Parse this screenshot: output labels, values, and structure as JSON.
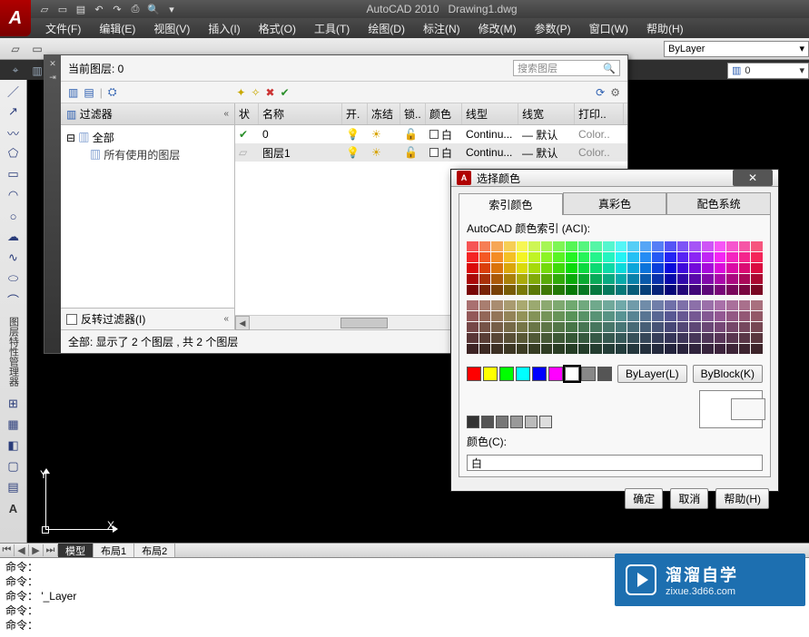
{
  "app": {
    "title": "AutoCAD 2010",
    "doc": "Drawing1.dwg"
  },
  "menu": {
    "file": "文件(F)",
    "edit": "编辑(E)",
    "view": "视图(V)",
    "insert": "插入(I)",
    "format": "格式(O)",
    "tools": "工具(T)",
    "draw": "绘图(D)",
    "dim": "标注(N)",
    "modify": "修改(M)",
    "param": "参数(P)",
    "window": "窗口(W)",
    "help": "帮助(H)"
  },
  "toolbar": {
    "bylayer": "ByLayer",
    "layer0": "0"
  },
  "ucs": {
    "x": "X",
    "y": "Y"
  },
  "tabs": {
    "model": "模型",
    "layout1": "布局1",
    "layout2": "布局2"
  },
  "cmd": {
    "l1": "命令：",
    "l2": "命令：",
    "l3": "命令： '_Layer",
    "l4": "命令：",
    "l5": "",
    "l6": "命令："
  },
  "layerPanel": {
    "currentLabel": "当前图层: 0",
    "searchPlaceholder": "搜索图层",
    "filterTitle": "过滤器",
    "treeAll": "全部",
    "treeUsed": "所有使用的图层",
    "invert": "反转过滤器(I)",
    "status": "全部: 显示了 2 个图层 , 共 2 个图层",
    "cols": {
      "state": "状",
      "name": "名称",
      "on": "开.",
      "freeze": "冻结",
      "lock": "锁..",
      "color": "颜色",
      "ltype": "线型",
      "lweight": "线宽",
      "print": "打印.."
    },
    "rows": [
      {
        "name": "0",
        "color": "白",
        "ltype": "Continu...",
        "lweight": "默认",
        "print": "Color.."
      },
      {
        "name": "图层1",
        "color": "白",
        "ltype": "Continu...",
        "lweight": "默认",
        "print": "Color.."
      }
    ]
  },
  "colorDlg": {
    "title": "选择颜色",
    "tabs": {
      "index": "索引颜色",
      "true": "真彩色",
      "book": "配色系统"
    },
    "aciLabel": "AutoCAD 颜色索引 (ACI):",
    "byLayer": "ByLayer(L)",
    "byBlock": "ByBlock(K)",
    "colorLabel": "颜色(C):",
    "colorValue": "白",
    "ok": "确定",
    "cancel": "取消",
    "help": "帮助(H)"
  },
  "watermark": {
    "t1": "溜溜自学",
    "t2": "zixue.3d66.com"
  }
}
